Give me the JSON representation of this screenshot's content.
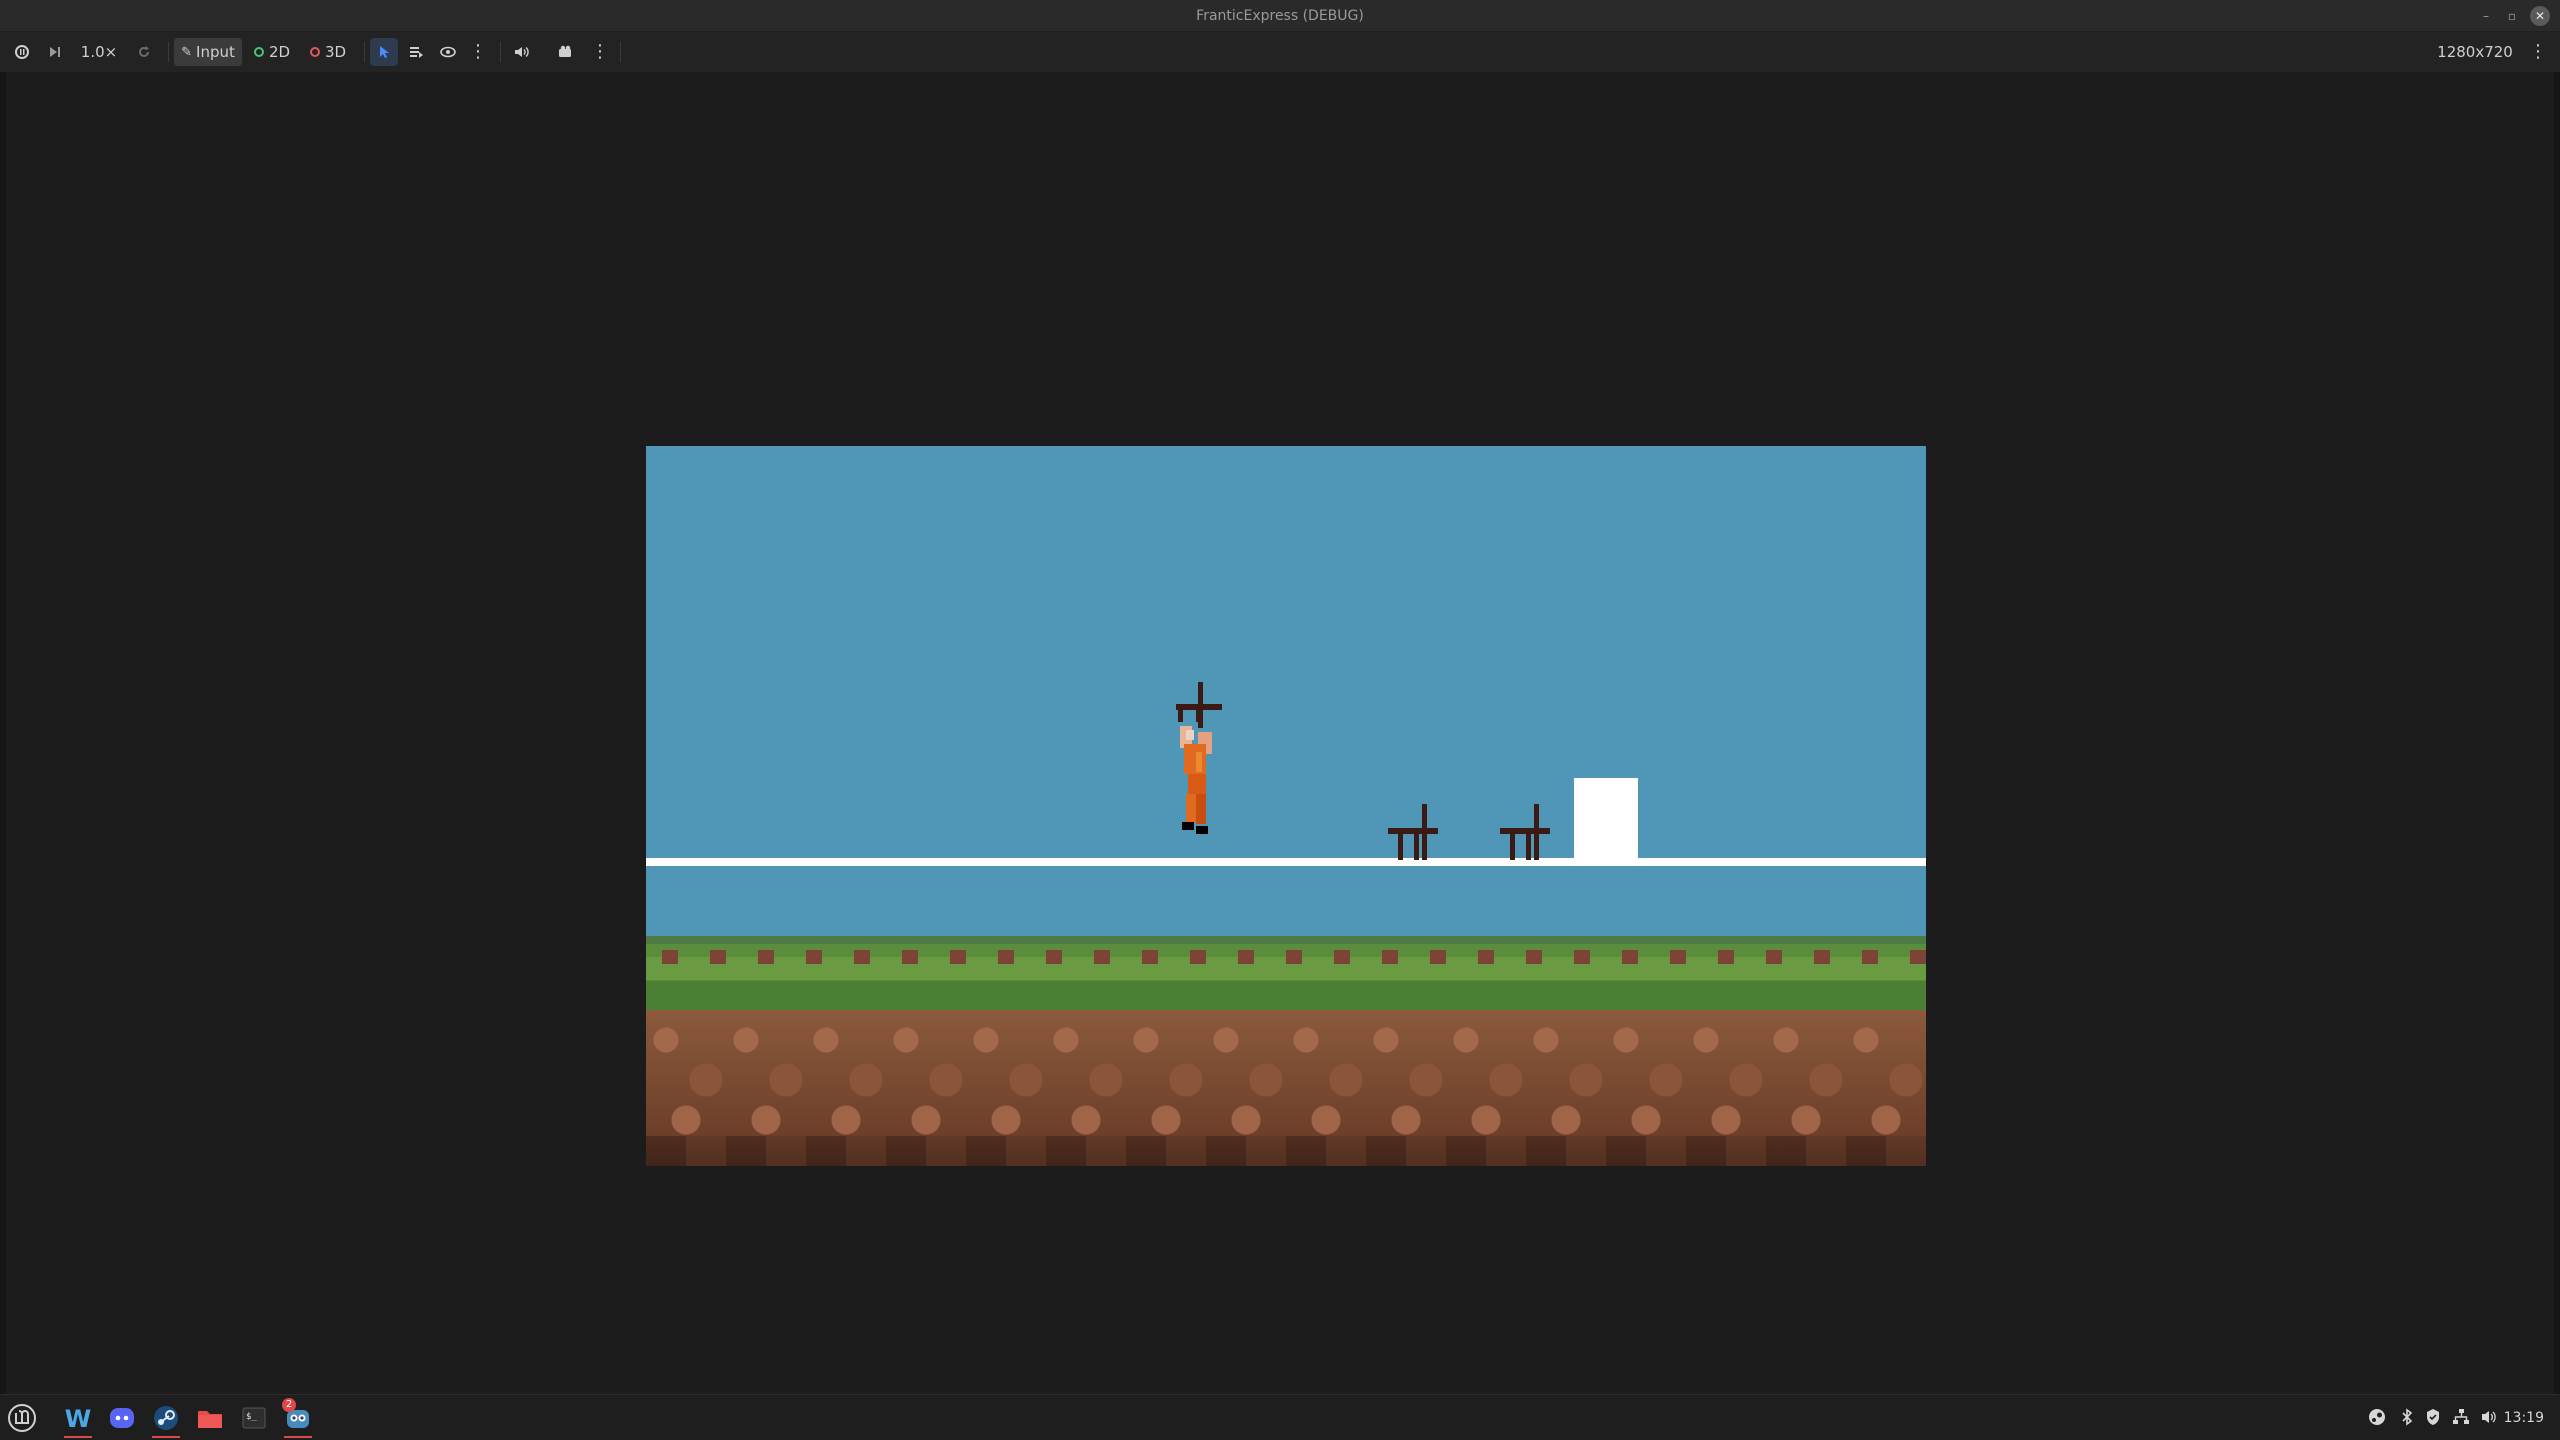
{
  "window": {
    "title": "FranticExpress (DEBUG)"
  },
  "toolbar": {
    "speed": "1.0×",
    "input_label": "Input",
    "mode_2d": "2D",
    "mode_3d": "3D",
    "resolution": "1280x720"
  },
  "colors": {
    "sky": "#5096b6",
    "ground_line": "#ffffff",
    "grass": "#5a8d3c",
    "dirt": "#8c5a3c",
    "mode_2d_ring": "#49c47a",
    "mode_3d_ring": "#e05a5a",
    "select_active": "#4a8cff"
  },
  "taskbar": {
    "apps": [
      {
        "name": "start-menu",
        "icon": "mint-menu-icon"
      },
      {
        "name": "writer",
        "icon": "w-app-icon"
      },
      {
        "name": "discord",
        "icon": "discord-icon"
      },
      {
        "name": "steam",
        "icon": "steam-icon"
      },
      {
        "name": "files",
        "icon": "folder-icon"
      },
      {
        "name": "terminal",
        "icon": "terminal-icon"
      },
      {
        "name": "godot",
        "icon": "godot-icon",
        "badge": "2"
      }
    ],
    "clock": "13:19"
  }
}
